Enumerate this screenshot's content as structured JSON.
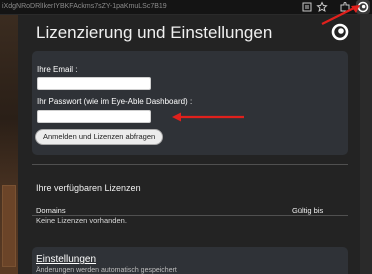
{
  "browser": {
    "url_fragment": "iXdgNRoDRlIkerIYBKFAckms7sZY-1paKmuLSc7B19"
  },
  "popup": {
    "title": "Lizenzierung und Einstellungen",
    "logo_icon": "eye-able-logo-icon",
    "email_label": "Ihre Email :",
    "email_value": "",
    "password_label": "Ihr Passwort (wie im Eye-Able Dashboard) :",
    "password_value": "",
    "submit_label": "Anmelden und Lizenzen abfragen",
    "licenses_heading": "Ihre verfügbaren Lizenzen",
    "table_headers": [
      "Domains",
      "Gültig bis"
    ],
    "no_licenses_text": "Keine Lizenzen vorhanden.",
    "settings_title": "Einstellungen",
    "settings_subtitle": "Änderungen werden automatisch gespeichert"
  },
  "annotations": {
    "arrow_color": "#e0201c"
  }
}
